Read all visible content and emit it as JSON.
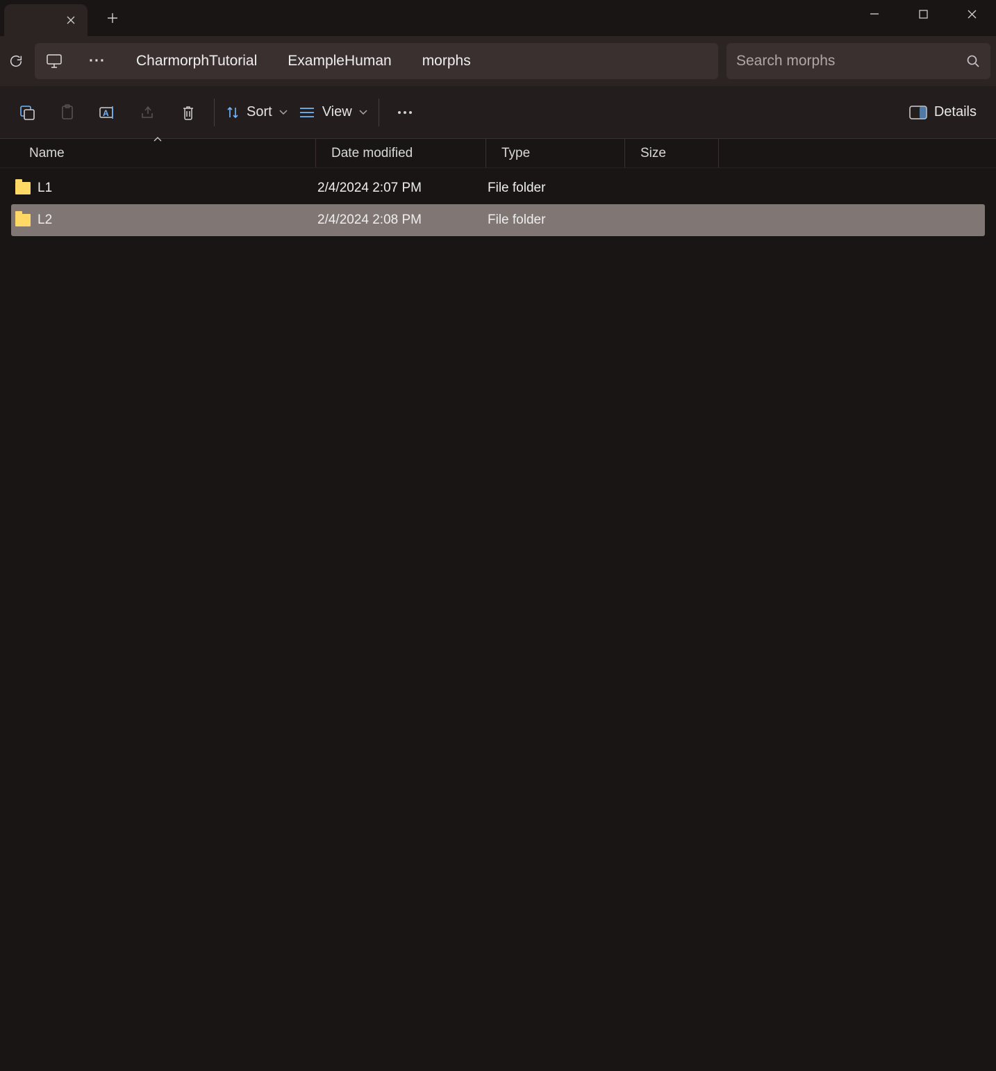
{
  "window": {
    "tab_close_title": "Close tab",
    "new_tab_title": "New tab",
    "minimize_title": "Minimize",
    "maximize_title": "Maximize",
    "close_title": "Close"
  },
  "nav": {
    "refresh_title": "Refresh"
  },
  "breadcrumb": {
    "items": [
      "CharmorphTutorial",
      "ExampleHuman",
      "morphs"
    ]
  },
  "search": {
    "placeholder": "Search morphs"
  },
  "toolbar": {
    "sort_label": "Sort",
    "view_label": "View",
    "details_label": "Details"
  },
  "columns": {
    "name": "Name",
    "date": "Date modified",
    "type": "Type",
    "size": "Size"
  },
  "rows": [
    {
      "name": "L1",
      "date": "2/4/2024 2:07 PM",
      "type": "File folder",
      "size": "",
      "selected": false
    },
    {
      "name": "L2",
      "date": "2/4/2024 2:08 PM",
      "type": "File folder",
      "size": "",
      "selected": true
    }
  ]
}
